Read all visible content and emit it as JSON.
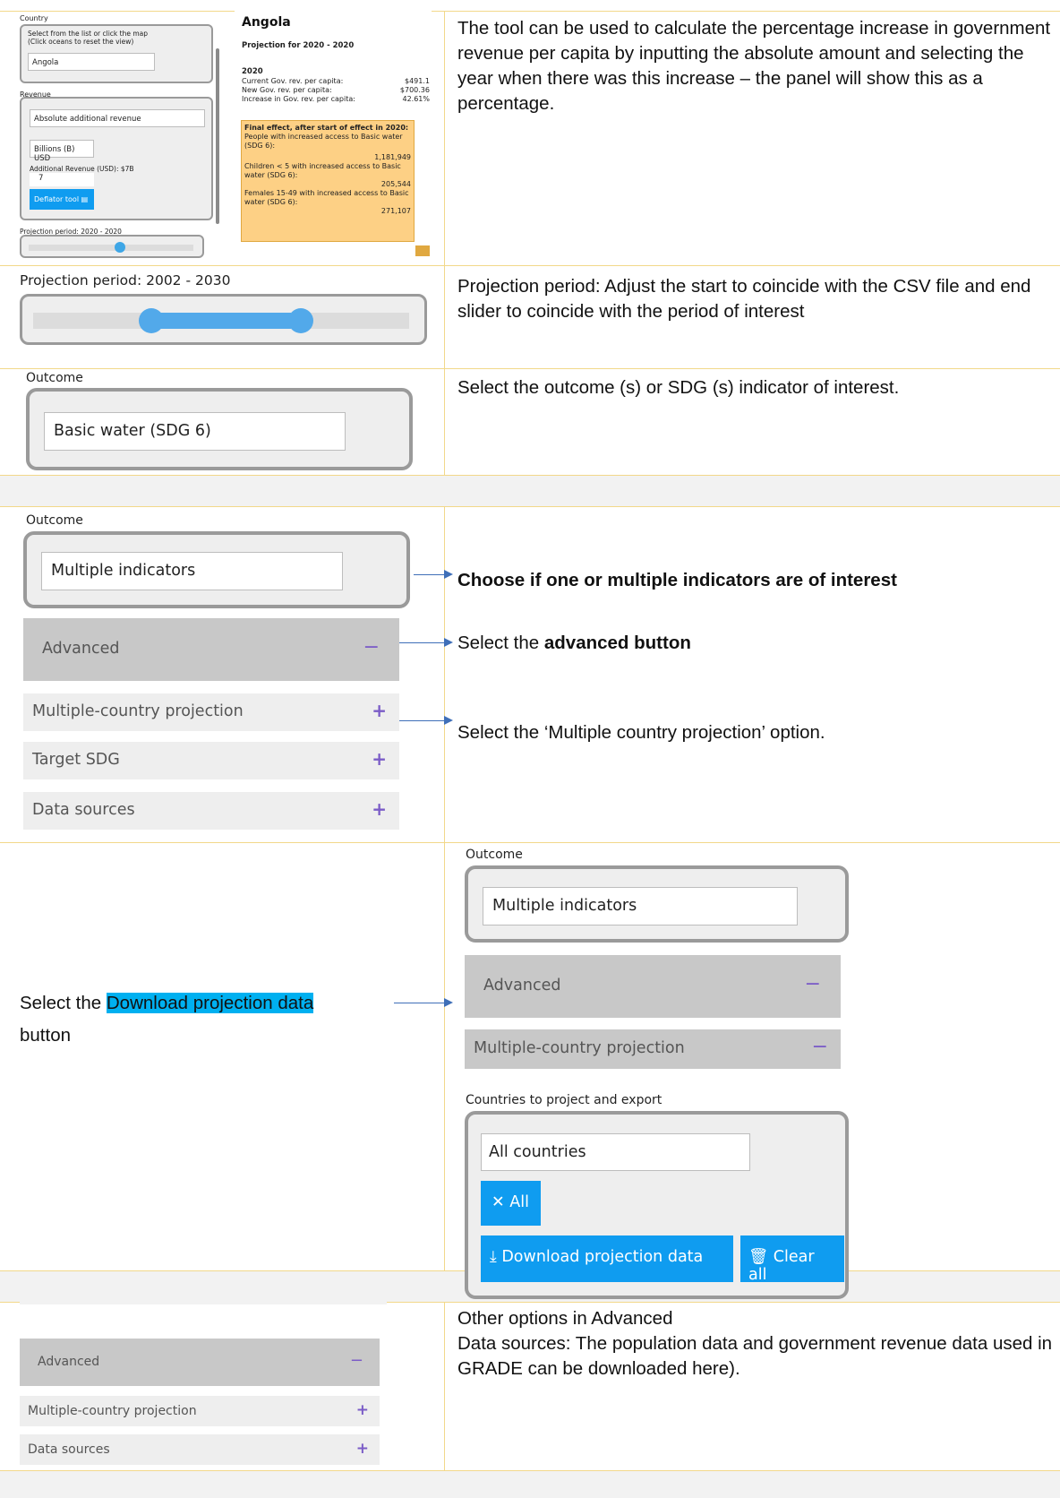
{
  "row1": {
    "country_label": "Country",
    "country_help_1": "Select from the list or click the map",
    "country_help_2": "(Click oceans to reset the view)",
    "country_value": "Angola",
    "revenue_label": "Revenue",
    "revenue_type": "Absolute additional revenue",
    "revenue_unit": "Billions (B) USD",
    "additional_revenue_label": "Additional Revenue (USD): $7B",
    "additional_revenue_value": "7",
    "deflator_button": "Deflator tool",
    "projection_label": "Projection period: 2020 - 2020",
    "panel_country": "Angola",
    "panel_projection": "Projection for 2020 - 2020",
    "panel_year": "2020",
    "stats": [
      {
        "label": "Current Gov. rev. per capita:",
        "value": "$491.1"
      },
      {
        "label": "New Gov. rev. per capita:",
        "value": "$700.36"
      },
      {
        "label": "Increase in Gov. rev. per capita:",
        "value": "42.61%"
      }
    ],
    "final_title": "Final effect, after start of effect in 2020:",
    "effects": [
      {
        "line1": "People with increased access to Basic water",
        "line2": "(SDG 6):",
        "value": "1,181,949"
      },
      {
        "line1": "Children < 5 with increased access to Basic",
        "line2": "water (SDG 6):",
        "value": "205,544"
      },
      {
        "line1": "Females 15-49 with increased access to Basic",
        "line2": "water (SDG 6):",
        "value": "271,107"
      }
    ],
    "description": "The tool can be used to calculate the percentage increase in government revenue per capita by inputting the absolute amount and selecting the year when there was this increase – the panel will show this as a percentage."
  },
  "row2": {
    "projection_label": "Projection period: 2002 - 2030",
    "description": "Projection period:  Adjust the start to coincide with the CSV file and end slider to coincide with the period of interest"
  },
  "row3": {
    "outcome_label": "Outcome",
    "outcome_value": "Basic water (SDG 6)",
    "description": "Select the outcome (s) or SDG (s) indicator of interest."
  },
  "row4": {
    "outcome_label": "Outcome",
    "outcome_value": "Multiple indicators",
    "advanced": "Advanced",
    "items": [
      "Multiple-country projection",
      "Target SDG",
      "Data sources"
    ],
    "note1": "Choose if one or multiple indicators are of interest",
    "note2_prefix": "Select the ",
    "note2_bold": "advanced button",
    "note3": "Select the ‘Multiple country projection’ option."
  },
  "row5": {
    "instruction_highlight": "Download projection data",
    "instruction_prefix": "Select the ",
    "instruction_suffix": "button",
    "outcome_label": "Outcome",
    "outcome_value": "Multiple indicators",
    "advanced": "Advanced",
    "mcp": "Multiple-country projection",
    "countries_label": "Countries to project and export",
    "countries_value": "All countries",
    "all_button": "All",
    "download_button": "Download projection data",
    "clear_button": "Clear all"
  },
  "row6": {
    "advanced": "Advanced",
    "items": [
      "Multiple-country projection",
      "Data sources"
    ],
    "line1": "Other options in Advanced",
    "line2": "Data sources: The population data and government revenue data used in GRADE can be downloaded here)."
  },
  "colors": {
    "accent": "#0f9cf0",
    "border": "#f2d88a",
    "highlight": "#00b0f0",
    "panel": "#fdd085"
  }
}
